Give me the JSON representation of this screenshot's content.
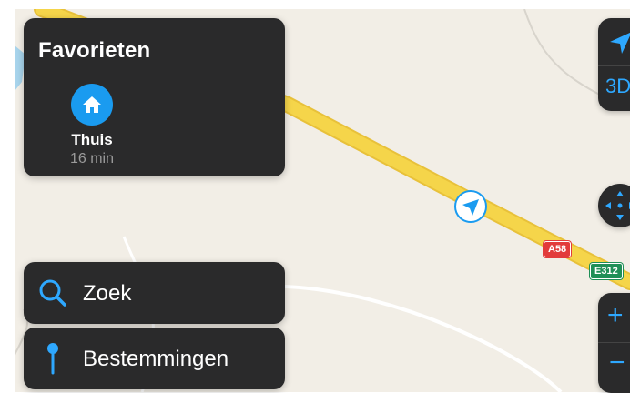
{
  "favorites": {
    "title": "Favorieten",
    "items": [
      {
        "icon": "home-icon",
        "name": "Thuis",
        "eta": "16 min"
      }
    ]
  },
  "search": {
    "label": "Zoek",
    "icon": "search-icon"
  },
  "destinations": {
    "label": "Bestemmingen",
    "icon": "pin-icon"
  },
  "map_controls": {
    "locate_icon": "location-arrow-icon",
    "three_d_label": "3D",
    "pan_icon": "pan-arrows-icon",
    "zoom_in_label": "+",
    "zoom_out_label": "−"
  },
  "road_labels": {
    "a58": "A58",
    "e312": "E312"
  },
  "colors": {
    "panel": "#2a2a2b",
    "accent": "#2ea8ff",
    "home_icon": "#1a9bf0",
    "map_bg": "#f2eee6",
    "highway": "#f5d54a",
    "shield_red": "#e23b3b",
    "shield_green": "#1f8f57"
  }
}
